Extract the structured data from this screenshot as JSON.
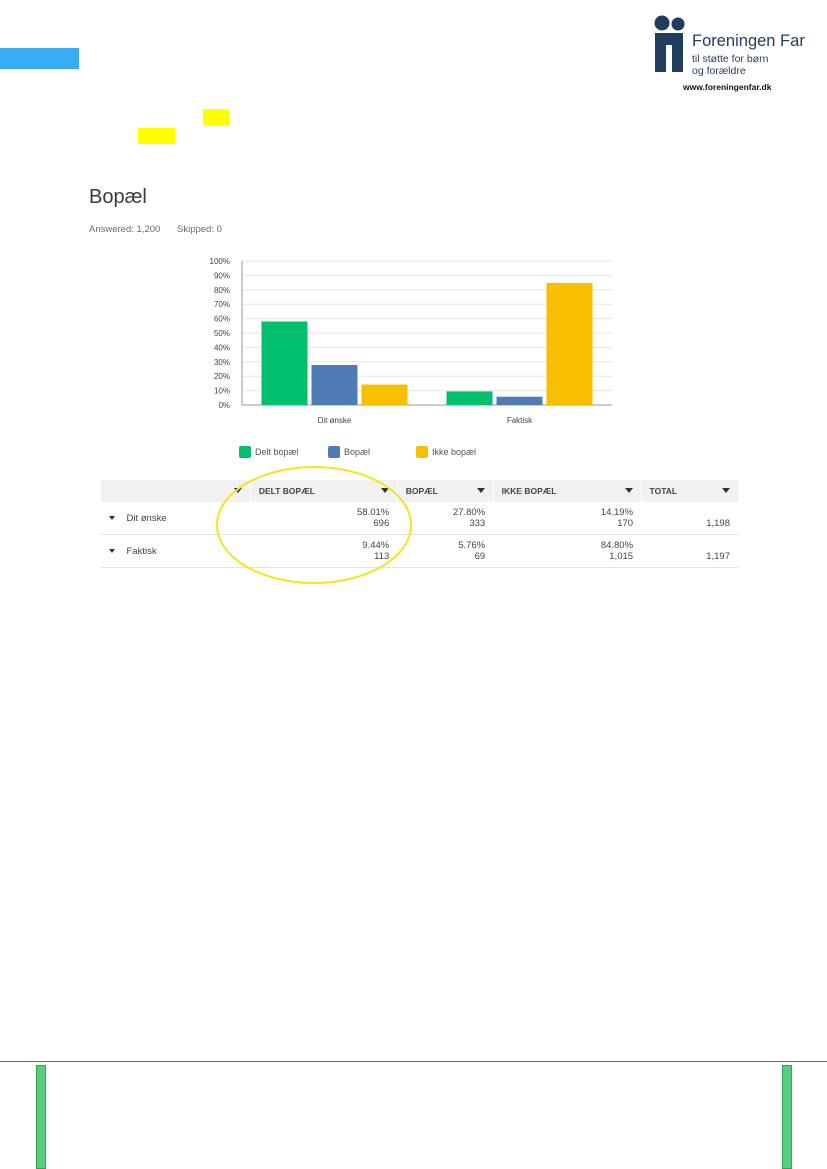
{
  "logo": {
    "name": "Foreningen Far",
    "tagline_line1": "til støtte for børn",
    "tagline_line2": "og forældre",
    "url": "www.foreningenfar.dk"
  },
  "question": {
    "title": "Bopæl",
    "answered": "Answered: 1,200",
    "skipped": "Skipped: 0"
  },
  "colors": {
    "green": "#00bf6f",
    "blue": "#507cb6",
    "orange": "#f8be00",
    "highlight": "#ffff00",
    "circle": "#f5e41a"
  },
  "chart_data": {
    "type": "bar",
    "categories": [
      "Dit ønske",
      "Faktisk"
    ],
    "series": [
      {
        "name": "Delt bopæl",
        "color": "#00bf6f",
        "values": [
          58.01,
          9.44
        ]
      },
      {
        "name": "Bopæl",
        "color": "#507cb6",
        "values": [
          27.8,
          5.76
        ]
      },
      {
        "name": "Ikke bopæl",
        "color": "#f8be00",
        "values": [
          14.19,
          84.8
        ]
      }
    ],
    "ylim": [
      0,
      100
    ],
    "yticks": [
      "0%",
      "10%",
      "20%",
      "30%",
      "40%",
      "50%",
      "60%",
      "70%",
      "80%",
      "90%",
      "100%"
    ],
    "grid": true,
    "legend": "bottom"
  },
  "table": {
    "headers": [
      "DELT BOPÆL",
      "BOPÆL",
      "IKKE BOPÆL",
      "TOTAL"
    ],
    "rows": [
      {
        "label": "Dit ønske",
        "cells": [
          [
            "58.01%",
            "696"
          ],
          [
            "27.80%",
            "333"
          ],
          [
            "14.19%",
            "170"
          ],
          [
            "",
            "1,198"
          ]
        ]
      },
      {
        "label": "Faktisk",
        "cells": [
          [
            "9.44%",
            "113"
          ],
          [
            "5.76%",
            "69"
          ],
          [
            "84.80%",
            "1,015"
          ],
          [
            "",
            "1,197"
          ]
        ]
      }
    ]
  }
}
